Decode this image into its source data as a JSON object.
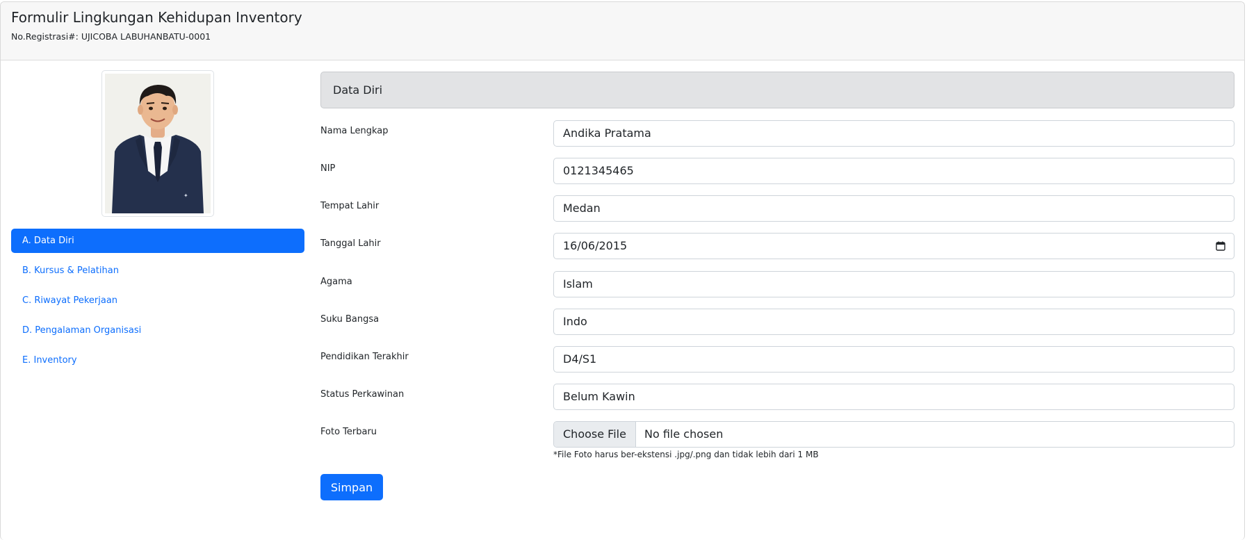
{
  "header": {
    "title": "Formulir Lingkungan Kehidupan Inventory",
    "subtitle": "No.Registrasi#: UJICOBA LABUHANBATU-0001"
  },
  "sidebar": {
    "items": [
      {
        "label": "A. Data Diri",
        "active": true
      },
      {
        "label": "B. Kursus & Pelatihan",
        "active": false
      },
      {
        "label": "C. Riwayat Pekerjaan",
        "active": false
      },
      {
        "label": "D. Pengalaman Organisasi",
        "active": false
      },
      {
        "label": "E. Inventory",
        "active": false
      }
    ]
  },
  "form": {
    "section_title": "Data Diri",
    "fields": [
      {
        "label": "Nama Lengkap",
        "value": "Andika Pratama"
      },
      {
        "label": "NIP",
        "value": "0121345465"
      },
      {
        "label": "Tempat Lahir",
        "value": "Medan"
      },
      {
        "label": "Tanggal Lahir",
        "value": "16/06/2015"
      },
      {
        "label": "Agama",
        "value": "Islam"
      },
      {
        "label": "Suku Bangsa",
        "value": "Indo"
      },
      {
        "label": "Pendidikan Terakhir",
        "value": "D4/S1"
      },
      {
        "label": "Status Perkawinan",
        "value": "Belum Kawin"
      }
    ],
    "photo_field": {
      "label": "Foto Terbaru",
      "button_label": "Choose File",
      "status": "No file chosen",
      "help": "*File Foto harus ber-ekstensi .jpg/.png dan tidak lebih dari 1 MB"
    },
    "submit_label": "Simpan"
  },
  "colors": {
    "primary": "#0d6efd",
    "section_header_bg": "#e2e3e5",
    "header_bg": "#f7f7f7"
  }
}
